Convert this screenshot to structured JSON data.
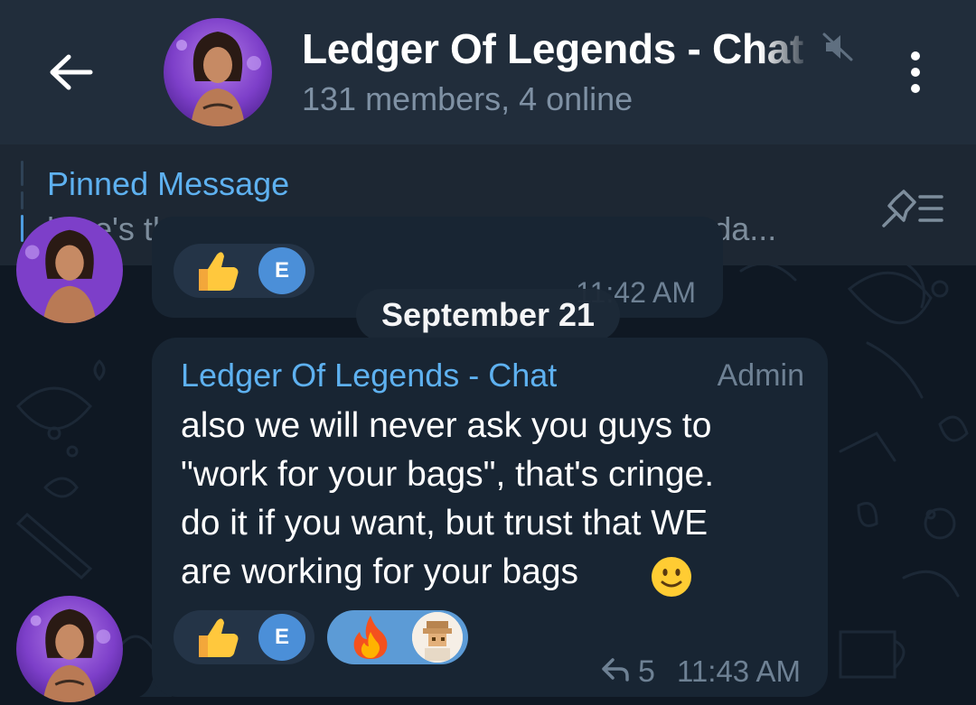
{
  "colors": {
    "header_bg": "#212d3b",
    "chat_bg": "#0f1823",
    "bubble_bg": "#182533",
    "accent_blue": "#5eb1f0",
    "secondary_text": "#7f91a4",
    "fire_reaction_bg": "#5c9bd6"
  },
  "header": {
    "back_icon": "arrow-left-icon",
    "title": "Ledger Of Legends - Chat",
    "mute_icon": "speaker-muted-icon",
    "subtitle": "131 members, 4 online",
    "menu_icon": "more-vertical-icon"
  },
  "pinned": {
    "label": "Pinned Message",
    "text": "here's the plan for the first test push coming toda...",
    "icon": "pinned-list-icon"
  },
  "messages": {
    "previous": {
      "time": "11:42 AM",
      "reactions": [
        {
          "emoji": "thumbs-up",
          "reactor_initial": "E"
        }
      ]
    },
    "date_separator": "September 21",
    "main": {
      "sender": "Ledger Of Legends - Chat",
      "role": "Admin",
      "lines": [
        "also we will never ask you guys to",
        "\"work for your bags\", that's cringe.",
        "do it if you want, but trust that WE",
        "are working for your bags"
      ],
      "trailing_emoji": "slightly-smiling-face",
      "reactions": [
        {
          "emoji": "thumbs-up",
          "reactor_initial": "E",
          "selected": false
        },
        {
          "emoji": "fire",
          "reactor": "pixel-art-avatar",
          "selected": true
        }
      ],
      "reply_count": "5",
      "time": "11:43 AM"
    }
  }
}
